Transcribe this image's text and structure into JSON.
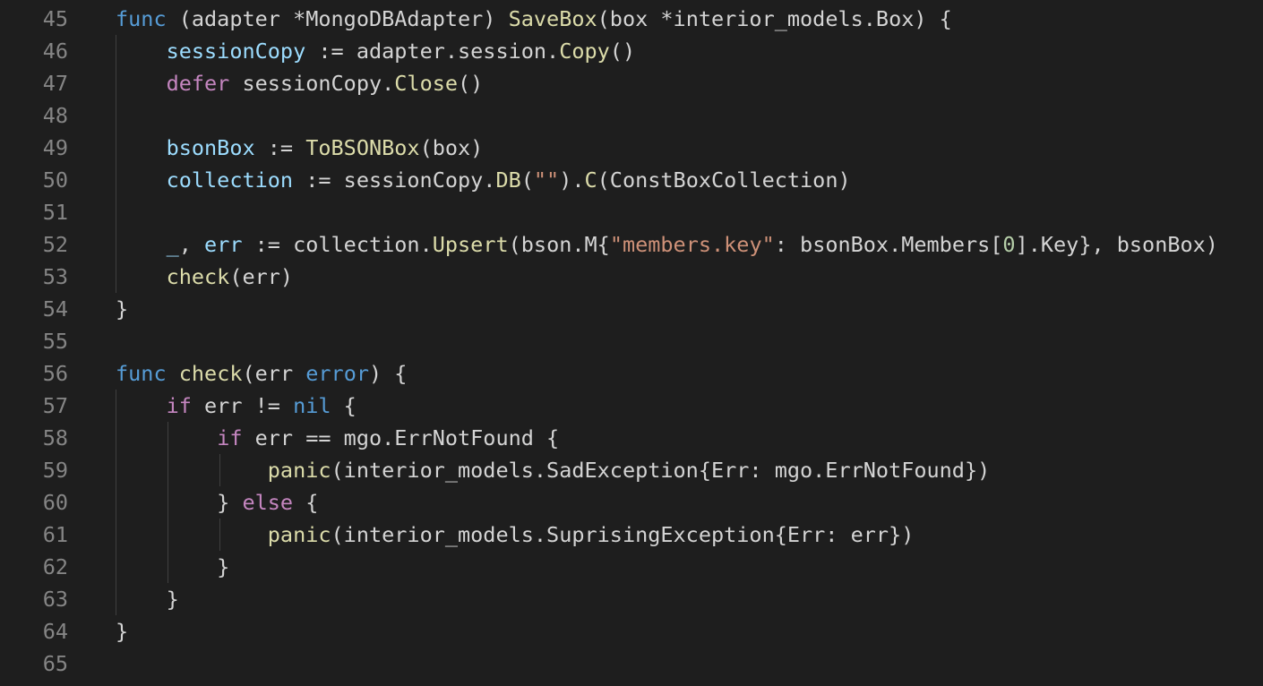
{
  "editor": {
    "language": "go",
    "colors": {
      "background": "#1e1e1e",
      "line_number": "#858585",
      "keyword": "#569cd6",
      "control": "#c586c0",
      "function": "#dcdcaa",
      "variable": "#9cdcfe",
      "string": "#ce9178",
      "number": "#b5cea8",
      "plain": "#d4d4d4"
    },
    "lines": [
      {
        "number": "45",
        "tokens": [
          {
            "t": "func",
            "c": "kw"
          },
          {
            "t": " (adapter *MongoDBAdapter) ",
            "c": "plain"
          },
          {
            "t": "SaveBox",
            "c": "fn"
          },
          {
            "t": "(box *interior_models.Box) {",
            "c": "plain"
          }
        ]
      },
      {
        "number": "46",
        "tokens": [
          {
            "t": "    ",
            "c": "plain"
          },
          {
            "t": "sessionCopy",
            "c": "var"
          },
          {
            "t": " := adapter.session.",
            "c": "plain"
          },
          {
            "t": "Copy",
            "c": "fn"
          },
          {
            "t": "()",
            "c": "plain"
          }
        ]
      },
      {
        "number": "47",
        "tokens": [
          {
            "t": "    ",
            "c": "plain"
          },
          {
            "t": "defer",
            "c": "ctl"
          },
          {
            "t": " sessionCopy.",
            "c": "plain"
          },
          {
            "t": "Close",
            "c": "fn"
          },
          {
            "t": "()",
            "c": "plain"
          }
        ]
      },
      {
        "number": "48",
        "tokens": []
      },
      {
        "number": "49",
        "tokens": [
          {
            "t": "    ",
            "c": "plain"
          },
          {
            "t": "bsonBox",
            "c": "var"
          },
          {
            "t": " := ",
            "c": "plain"
          },
          {
            "t": "ToBSONBox",
            "c": "fn"
          },
          {
            "t": "(box)",
            "c": "plain"
          }
        ]
      },
      {
        "number": "50",
        "tokens": [
          {
            "t": "    ",
            "c": "plain"
          },
          {
            "t": "collection",
            "c": "var"
          },
          {
            "t": " := sessionCopy.",
            "c": "plain"
          },
          {
            "t": "DB",
            "c": "fn"
          },
          {
            "t": "(",
            "c": "plain"
          },
          {
            "t": "\"\"",
            "c": "str"
          },
          {
            "t": ").",
            "c": "plain"
          },
          {
            "t": "C",
            "c": "fn"
          },
          {
            "t": "(ConstBoxCollection)",
            "c": "plain"
          }
        ]
      },
      {
        "number": "51",
        "tokens": []
      },
      {
        "number": "52",
        "tokens": [
          {
            "t": "    ",
            "c": "plain"
          },
          {
            "t": "_",
            "c": "var"
          },
          {
            "t": ", ",
            "c": "plain"
          },
          {
            "t": "err",
            "c": "var"
          },
          {
            "t": " := collection.",
            "c": "plain"
          },
          {
            "t": "Upsert",
            "c": "fn"
          },
          {
            "t": "(bson.M{",
            "c": "plain"
          },
          {
            "t": "\"members.key\"",
            "c": "str"
          },
          {
            "t": ": bsonBox.Members[",
            "c": "plain"
          },
          {
            "t": "0",
            "c": "num"
          },
          {
            "t": "].Key}, bsonBox)",
            "c": "plain"
          }
        ]
      },
      {
        "number": "53",
        "tokens": [
          {
            "t": "    ",
            "c": "plain"
          },
          {
            "t": "check",
            "c": "fn"
          },
          {
            "t": "(err)",
            "c": "plain"
          }
        ]
      },
      {
        "number": "54",
        "tokens": [
          {
            "t": "}",
            "c": "plain"
          }
        ]
      },
      {
        "number": "55",
        "tokens": []
      },
      {
        "number": "56",
        "tokens": [
          {
            "t": "func",
            "c": "kw"
          },
          {
            "t": " ",
            "c": "plain"
          },
          {
            "t": "check",
            "c": "fn"
          },
          {
            "t": "(err ",
            "c": "plain"
          },
          {
            "t": "error",
            "c": "kw"
          },
          {
            "t": ") {",
            "c": "plain"
          }
        ]
      },
      {
        "number": "57",
        "tokens": [
          {
            "t": "    ",
            "c": "plain"
          },
          {
            "t": "if",
            "c": "ctl"
          },
          {
            "t": " err != ",
            "c": "plain"
          },
          {
            "t": "nil",
            "c": "kw"
          },
          {
            "t": " {",
            "c": "plain"
          }
        ]
      },
      {
        "number": "58",
        "tokens": [
          {
            "t": "        ",
            "c": "plain"
          },
          {
            "t": "if",
            "c": "ctl"
          },
          {
            "t": " err == mgo.ErrNotFound {",
            "c": "plain"
          }
        ]
      },
      {
        "number": "59",
        "tokens": [
          {
            "t": "            ",
            "c": "plain"
          },
          {
            "t": "panic",
            "c": "fn"
          },
          {
            "t": "(interior_models.SadException{Err: mgo.ErrNotFound})",
            "c": "plain"
          }
        ]
      },
      {
        "number": "60",
        "tokens": [
          {
            "t": "        } ",
            "c": "plain"
          },
          {
            "t": "else",
            "c": "ctl"
          },
          {
            "t": " {",
            "c": "plain"
          }
        ]
      },
      {
        "number": "61",
        "tokens": [
          {
            "t": "            ",
            "c": "plain"
          },
          {
            "t": "panic",
            "c": "fn"
          },
          {
            "t": "(interior_models.SuprisingException{Err: err})",
            "c": "plain"
          }
        ]
      },
      {
        "number": "62",
        "tokens": [
          {
            "t": "        }",
            "c": "plain"
          }
        ]
      },
      {
        "number": "63",
        "tokens": [
          {
            "t": "    }",
            "c": "plain"
          }
        ]
      },
      {
        "number": "64",
        "tokens": [
          {
            "t": "}",
            "c": "plain"
          }
        ]
      },
      {
        "number": "65",
        "tokens": []
      }
    ]
  }
}
